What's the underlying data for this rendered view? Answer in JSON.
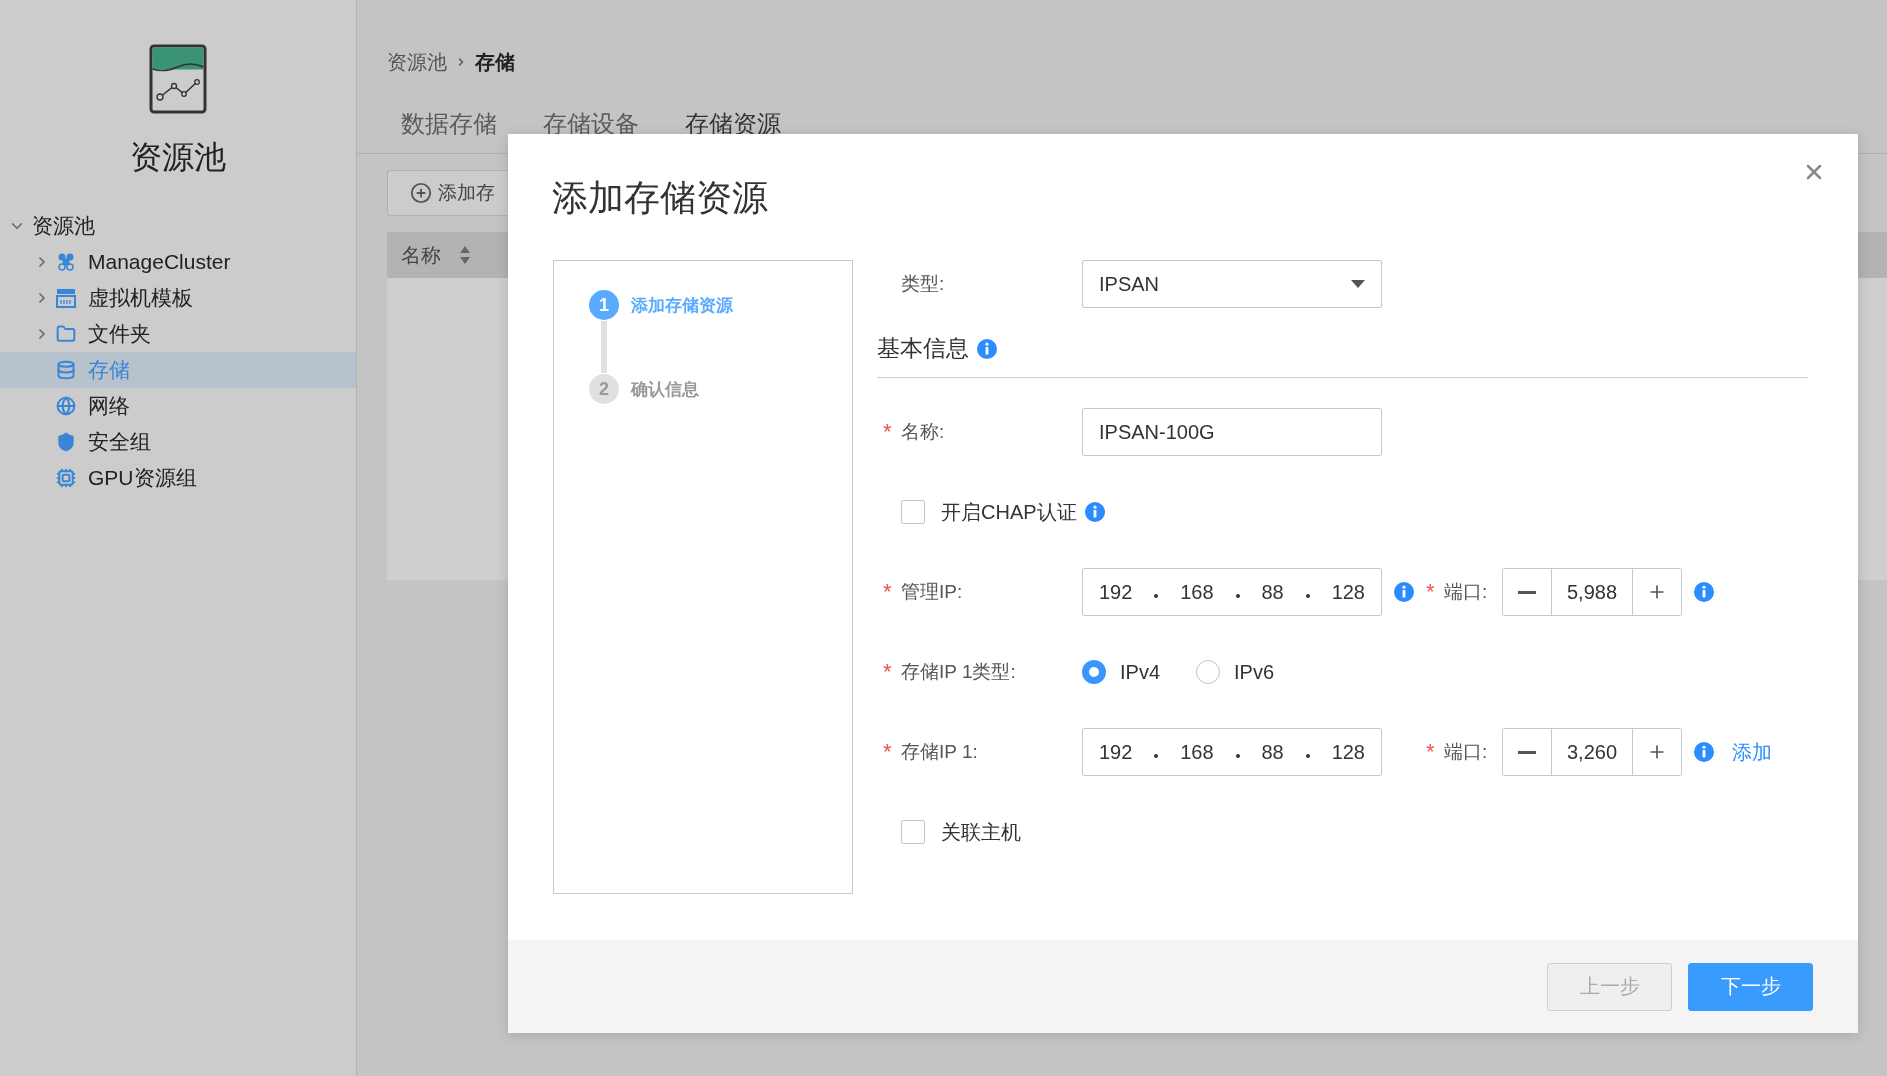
{
  "sidebar": {
    "title": "资源池",
    "tree": {
      "label": "资源池",
      "expanded": true,
      "children": [
        {
          "label": "ManageCluster",
          "kind": "group",
          "expanded": false,
          "selected": false
        },
        {
          "label": "虚拟机模板",
          "kind": "group",
          "expanded": false,
          "selected": false
        },
        {
          "label": "文件夹",
          "kind": "group",
          "expanded": false,
          "selected": false
        },
        {
          "label": "存储",
          "kind": "leaf",
          "selected": true
        },
        {
          "label": "网络",
          "kind": "leaf",
          "selected": false
        },
        {
          "label": "安全组",
          "kind": "leaf",
          "selected": false
        },
        {
          "label": "GPU资源组",
          "kind": "leaf",
          "selected": false
        }
      ]
    }
  },
  "main": {
    "breadcrumb": [
      "资源池",
      "存储"
    ],
    "tabs": [
      {
        "label": "数据存储",
        "selected": false
      },
      {
        "label": "存储设备",
        "selected": false
      },
      {
        "label": "存储资源",
        "selected": true
      }
    ],
    "add_button": "添加存",
    "table": {
      "columns": [
        "名称"
      ]
    }
  },
  "dialog": {
    "title": "添加存储资源",
    "steps": [
      {
        "number": "1",
        "label": "添加存储资源",
        "selected": true
      },
      {
        "number": "2",
        "label": "确认信息",
        "selected": false
      }
    ],
    "type_field": {
      "label": "类型:",
      "value": "IPSAN"
    },
    "section": {
      "title": "基本信息",
      "info": true
    },
    "rows": [
      {
        "kind": "text",
        "required_mark": "*",
        "label": "名称:",
        "value": "IPSAN-100G"
      },
      {
        "kind": "checkbox",
        "label": "开启CHAP认证",
        "checked": false,
        "info": true
      },
      {
        "kind": "ip",
        "required_mark": "*",
        "label": "管理IP:",
        "octets": [
          "192",
          "168",
          "88",
          "128"
        ],
        "info": true,
        "port": {
          "required_mark": "*",
          "label": "端口:",
          "value": "5,988",
          "info": true
        }
      },
      {
        "kind": "radio",
        "required_mark": "*",
        "label": "存储IP 1类型:",
        "options": [
          {
            "label": "IPv4",
            "selected": true
          },
          {
            "label": "IPv6",
            "selected": false
          }
        ]
      },
      {
        "kind": "ip",
        "required_mark": "*",
        "label": "存储IP 1:",
        "octets": [
          "192",
          "168",
          "88",
          "128"
        ],
        "info": false,
        "port": {
          "required_mark": "*",
          "label": "端口:",
          "value": "3,260",
          "info": true,
          "link": "添加"
        }
      },
      {
        "kind": "checkbox",
        "label": "关联主机",
        "checked": false,
        "info": false
      }
    ],
    "buttons": [
      {
        "label": "上一步",
        "disabled": true
      },
      {
        "label": "下一步",
        "disabled": false
      }
    ]
  }
}
